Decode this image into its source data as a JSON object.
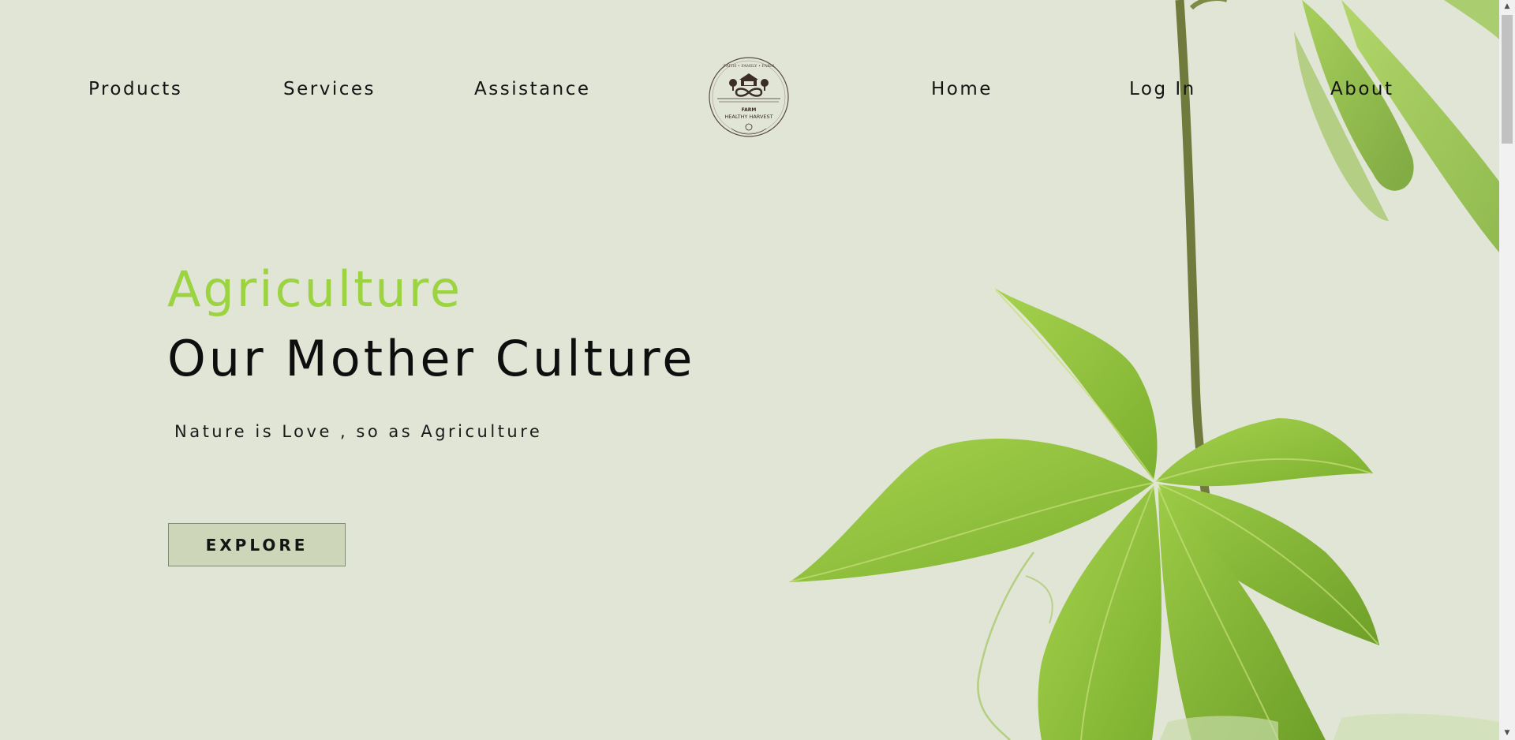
{
  "nav": {
    "left": [
      "Products",
      "Services",
      "Assistance"
    ],
    "right": [
      "Home",
      "Log In",
      "About"
    ]
  },
  "logo": {
    "top_text": "FAITH • FAMILY • FARM",
    "middle_text": "FARM",
    "bottom_text": "HEALTHY HARVEST"
  },
  "hero": {
    "accent": "Agriculture",
    "title": "Our Mother Culture",
    "tagline": "Nature is Love , so as Agriculture",
    "button": "EXPLORE"
  },
  "colors": {
    "background": "#e1e5d6",
    "accent": "#9bd341",
    "button_border": "#c8713a",
    "button_fill": "#cdd6b9",
    "leaf": "#8cc43a"
  },
  "scrollbar": {
    "up_icon": "arrow-up-icon",
    "down_icon": "arrow-down-icon"
  }
}
